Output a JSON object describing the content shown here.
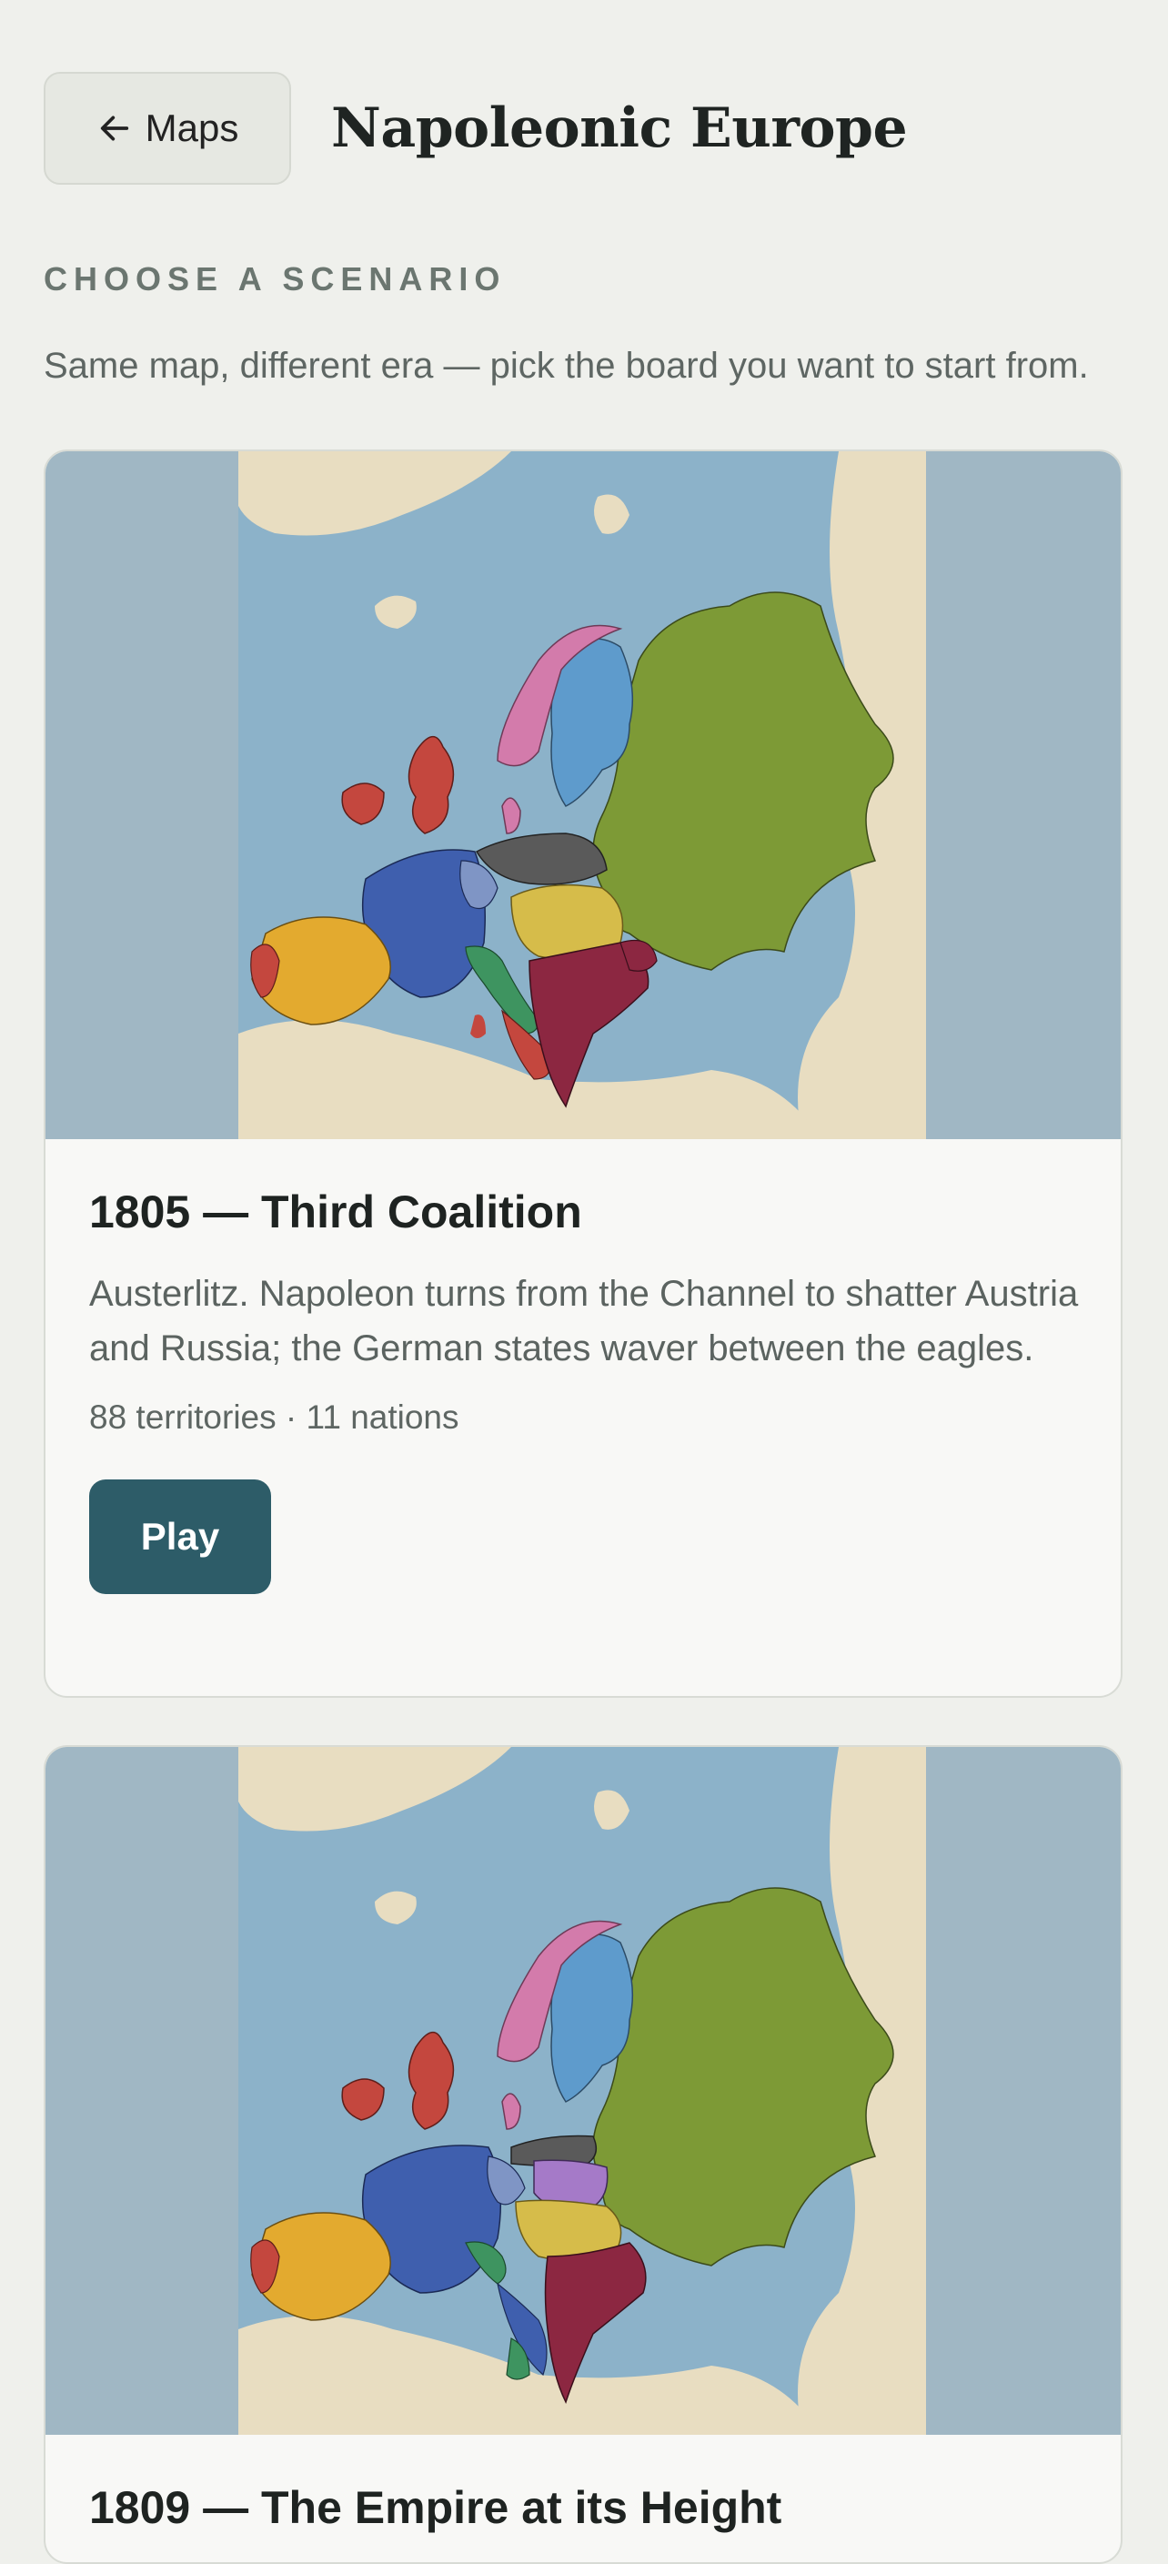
{
  "header": {
    "back_label": "Maps",
    "title": "Napoleonic Europe"
  },
  "section_label": "CHOOSE A SCENARIO",
  "intro_text": "Same map, different era — pick the board you want to start from.",
  "scenarios": [
    {
      "title": "1805 — Third Coalition",
      "description": "Austerlitz. Napoleon turns from the Channel to shatter Austria and Russia; the German states waver between the eagles.",
      "meta": "88 territories · 11 nations",
      "play_label": "Play"
    },
    {
      "title": "1809 — The Empire at its Height"
    }
  ],
  "colors": {
    "background": "#eff0ec",
    "sea": "#8cb2c9",
    "land": "#e8ddc1",
    "france": "#3f5fae",
    "britain": "#c4473e",
    "spain": "#e3aa2f",
    "russia": "#7d9a36",
    "ottoman": "#8c2741",
    "sweden": "#5e9bcc",
    "denmark_norway": "#d37bab",
    "prussia": "#5a5a5a",
    "austria": "#d6bc4a",
    "italy": "#3e9460",
    "confederation_rhine": "#a57ac8",
    "play_button": "#2d5c68"
  }
}
